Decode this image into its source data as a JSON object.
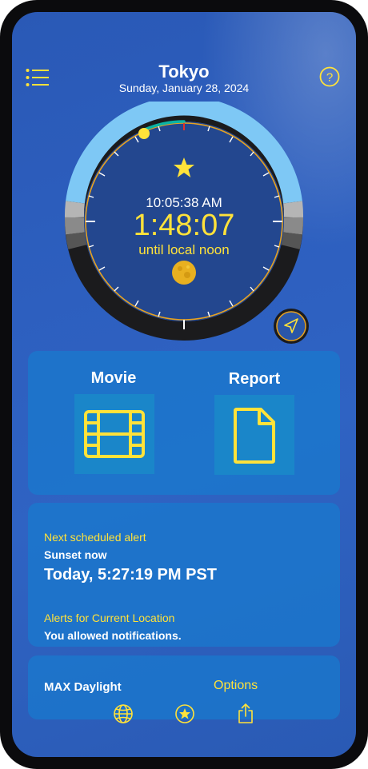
{
  "header": {
    "city": "Tokyo",
    "date": "Sunday, January 28, 2024",
    "menu_icon": "list-icon",
    "help_icon": "question-circle-icon"
  },
  "clock": {
    "current_time": "10:05:38 AM",
    "countdown": "1:48:07",
    "countdown_label": "until local noon",
    "sun_icon": "star-icon",
    "moon_icon": "moon-icon",
    "location_icon": "location-arrow-icon"
  },
  "actions": {
    "movie_label": "Movie",
    "movie_icon": "film-icon",
    "report_label": "Report",
    "report_icon": "document-icon"
  },
  "alerts": {
    "next_heading": "Next scheduled alert",
    "next_event": "Sunset now",
    "next_time": "Today, 5:27:19 PM PST",
    "location_heading": "Alerts for Current Location",
    "location_status": "You allowed notifications."
  },
  "daylight": {
    "title": "MAX Daylight",
    "options_label": "Options"
  },
  "tabbar": {
    "globe_icon": "globe-icon",
    "favorite_icon": "star-circle-icon",
    "share_icon": "share-icon"
  },
  "colors": {
    "accent": "#ffe23a",
    "background": "#2d5fbf",
    "card": "#1978cd",
    "day_arc": "#7ec8f5",
    "night_arc": "#1b1b1d"
  }
}
